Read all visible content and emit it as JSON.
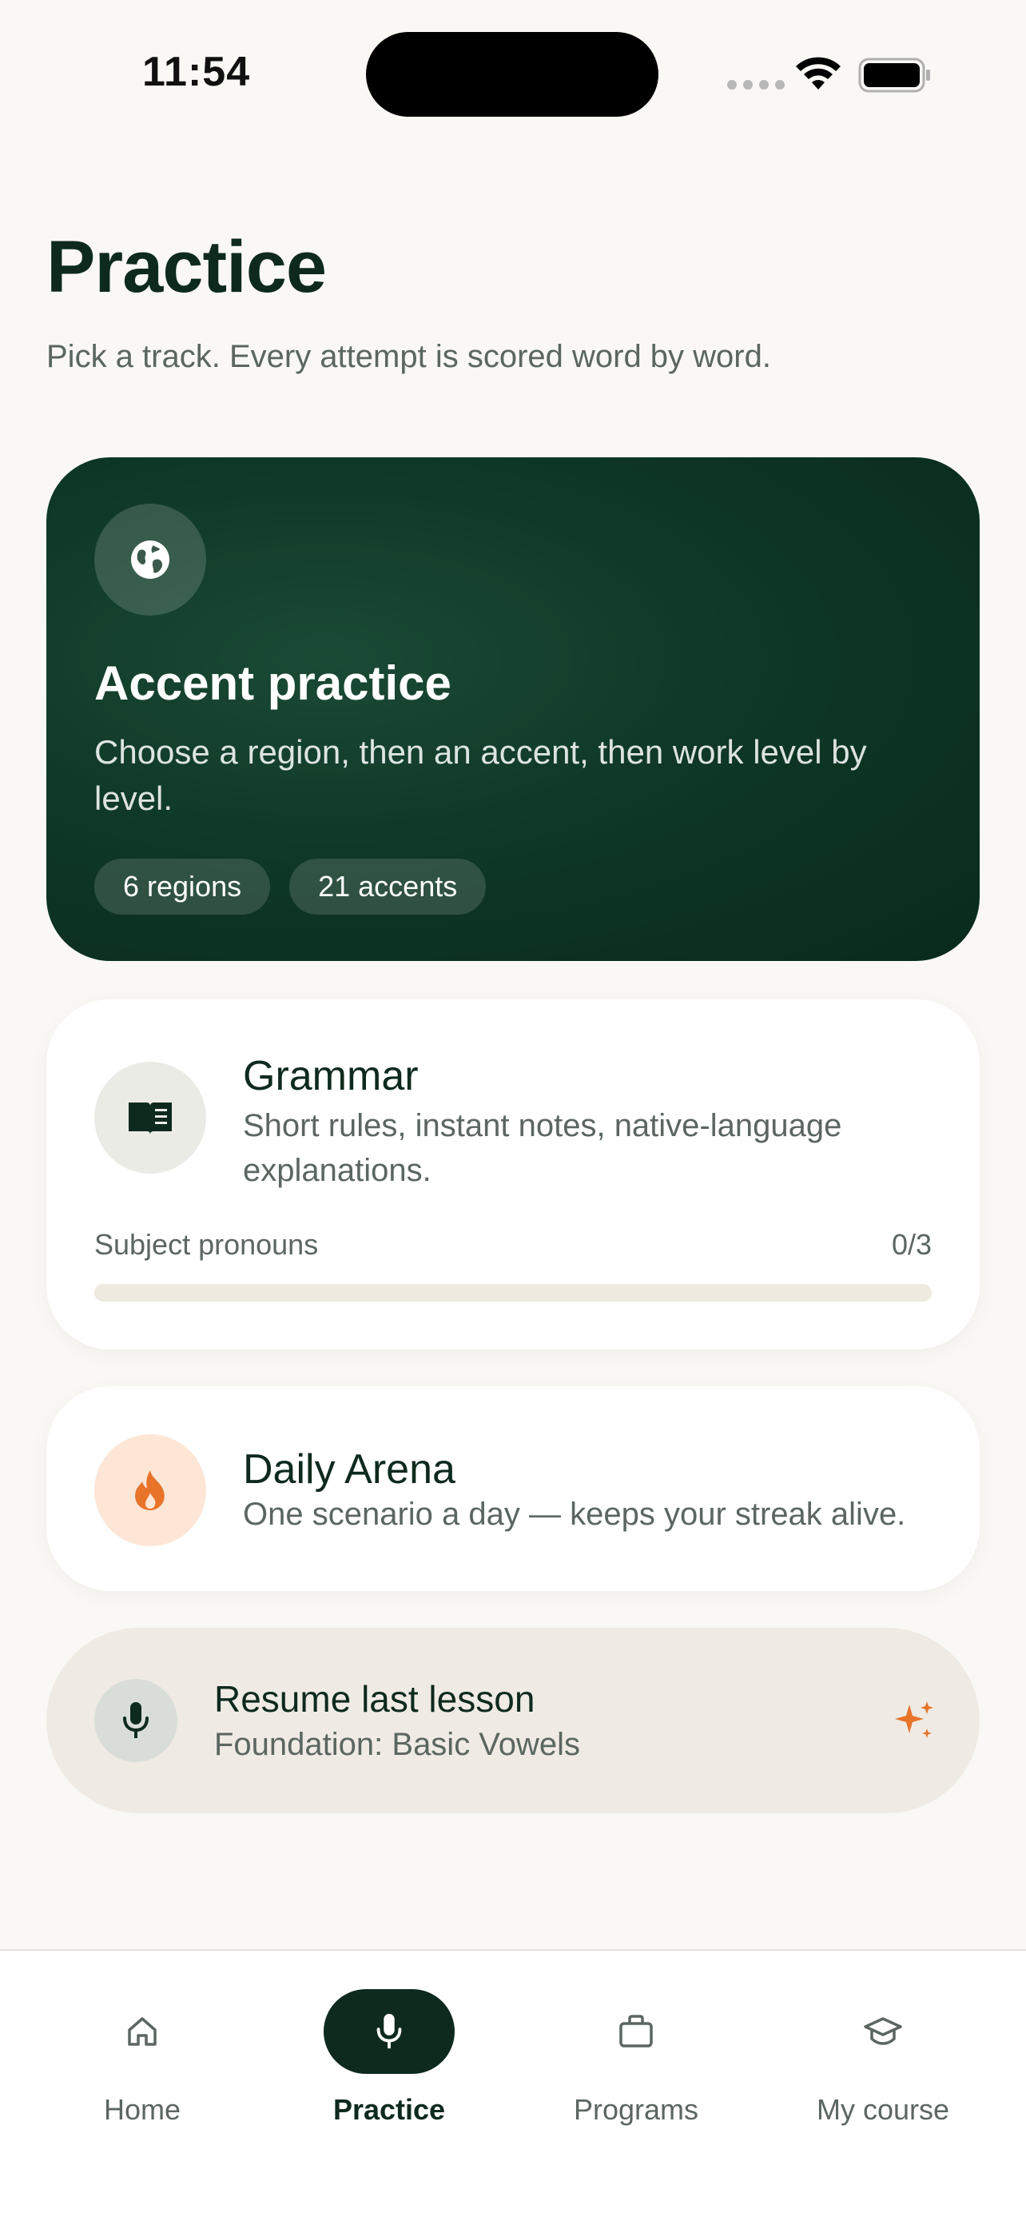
{
  "status_bar": {
    "time": "11:54"
  },
  "header": {
    "title": "Practice",
    "subtitle": "Pick a track. Every attempt is scored word by word."
  },
  "accent_card": {
    "icon": "globe-icon",
    "title": "Accent practice",
    "description": "Choose a region, then an accent, then work level by level.",
    "chips": [
      "6 regions",
      "21 accents"
    ]
  },
  "grammar_card": {
    "icon": "book-icon",
    "title": "Grammar",
    "description": "Short rules, instant notes, native-language explanations.",
    "progress_label": "Subject pronouns",
    "progress_count": "0/3",
    "progress_fraction": 0
  },
  "arena_card": {
    "icon": "flame-icon",
    "title": "Daily Arena",
    "description": "One scenario a day — keeps your streak alive."
  },
  "resume_card": {
    "icon": "microphone-icon",
    "title": "Resume last lesson",
    "subtitle": "Foundation: Basic Vowels",
    "accessory_icon": "sparkle-icon"
  },
  "bottom_nav": {
    "items": [
      {
        "label": "Home",
        "icon": "home-icon",
        "active": false
      },
      {
        "label": "Practice",
        "icon": "microphone-icon",
        "active": true
      },
      {
        "label": "Programs",
        "icon": "briefcase-icon",
        "active": false
      },
      {
        "label": "My course",
        "icon": "graduation-cap-icon",
        "active": false
      }
    ]
  },
  "colors": {
    "background": "#f9f8f4",
    "primary_dark": "#0e2a1e",
    "accent_orange": "#e8742a",
    "muted_text": "#5c6661"
  }
}
